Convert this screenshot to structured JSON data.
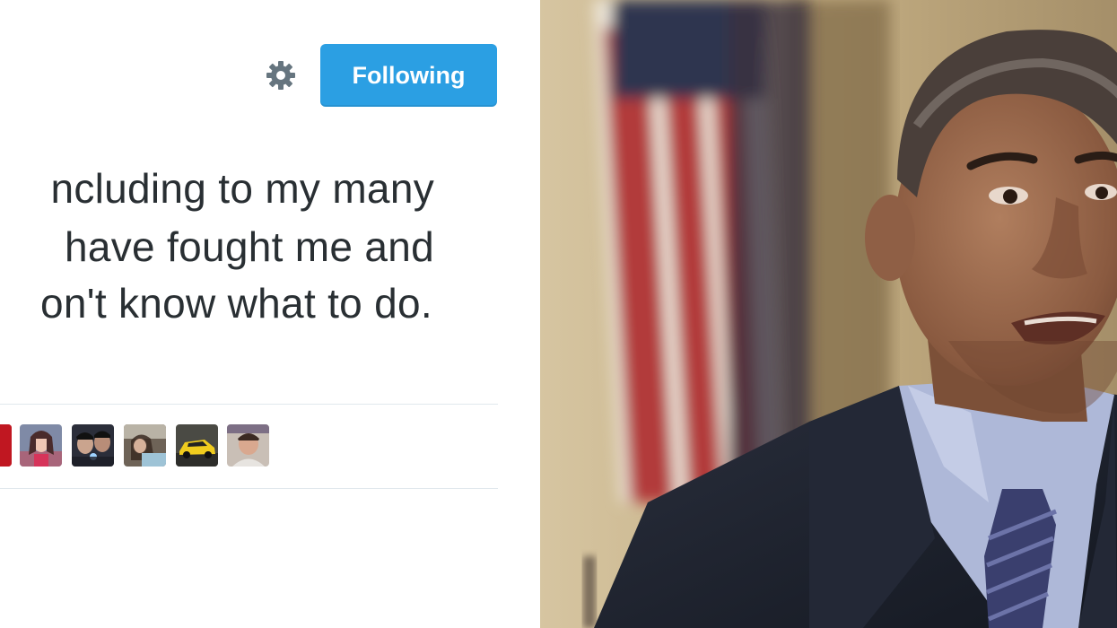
{
  "tweet": {
    "follow_button_label": "Following",
    "settings_icon": "gear-icon",
    "lines": [
      "ncluding to my many",
      "have fought me and",
      "on't know what to do."
    ]
  },
  "likers": {
    "avatars": [
      {
        "icon": "avatar-red-partial"
      },
      {
        "icon": "avatar-woman-pink"
      },
      {
        "icon": "avatar-two-people"
      },
      {
        "icon": "avatar-people-outdoor"
      },
      {
        "icon": "avatar-yellow-car"
      },
      {
        "icon": "avatar-man-portrait"
      }
    ]
  },
  "photo": {
    "icon": "man-speaking-photo",
    "colors": {
      "wall": "#c9b48c",
      "flag_red": "#b23a3a",
      "suit": "#1f2430",
      "shirt": "#aeb8d8",
      "tie": "#3a3f6e"
    }
  },
  "colors": {
    "accent": "#2b9fe3",
    "text": "#292f33",
    "divider": "#e1e8ed"
  }
}
